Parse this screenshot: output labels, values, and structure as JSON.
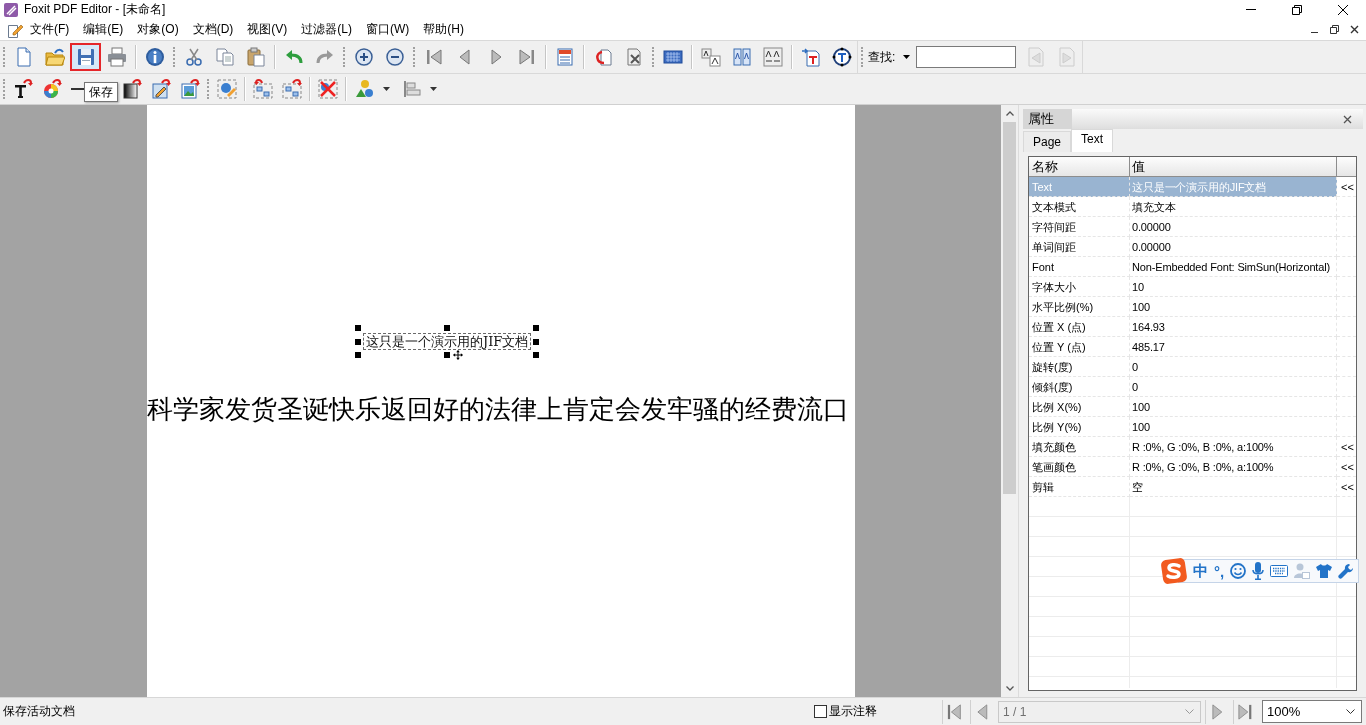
{
  "window": {
    "title": "Foxit PDF Editor - [未命名]"
  },
  "menu": {
    "items": [
      "文件(F)",
      "编辑(E)",
      "对象(O)",
      "文档(D)",
      "视图(V)",
      "过滤器(L)",
      "窗口(W)",
      "帮助(H)"
    ]
  },
  "toolbar_1": {
    "bands": [
      {
        "groups": [
          [
            {
              "kind": "new",
              "highlighted": false
            },
            {
              "kind": "open",
              "highlighted": false
            },
            {
              "kind": "save",
              "highlighted": true
            },
            {
              "kind": "print",
              "highlighted": false
            }
          ],
          [
            {
              "kind": "info",
              "highlighted": false
            }
          ]
        ]
      },
      {
        "groups": [
          [
            {
              "kind": "cut",
              "highlighted": false
            },
            {
              "kind": "copy",
              "highlighted": false
            },
            {
              "kind": "paste",
              "highlighted": false
            }
          ],
          [
            {
              "kind": "undo",
              "highlighted": false
            },
            {
              "kind": "redo",
              "highlighted": false
            }
          ]
        ]
      },
      {
        "groups": [
          [
            {
              "kind": "zoom-in",
              "highlighted": false
            },
            {
              "kind": "zoom-out",
              "highlighted": false
            }
          ]
        ]
      },
      {
        "groups": [
          [
            {
              "kind": "first-page",
              "highlighted": false
            },
            {
              "kind": "previous-page",
              "highlighted": false
            },
            {
              "kind": "next-page",
              "highlighted": false
            },
            {
              "kind": "last-page",
              "highlighted": false
            }
          ],
          [
            {
              "kind": "page-properties",
              "highlighted": false
            }
          ],
          [
            {
              "kind": "rotate-page",
              "highlighted": false
            },
            {
              "kind": "delete-page",
              "highlighted": false
            }
          ]
        ]
      },
      {
        "groups": [
          [
            {
              "kind": "text-grid",
              "highlighted": false
            }
          ],
          [
            {
              "kind": "char-spacing",
              "highlighted": false
            },
            {
              "kind": "word-spacing",
              "highlighted": false
            },
            {
              "kind": "text-scale",
              "highlighted": false
            }
          ],
          [
            {
              "kind": "import-text",
              "highlighted": false
            },
            {
              "kind": "text-frame",
              "highlighted": false
            }
          ]
        ]
      }
    ],
    "find": {
      "label": "查找:",
      "buttons": [
        {
          "kind": "find-previous",
          "disabled": true
        },
        {
          "kind": "find-next",
          "disabled": true
        }
      ]
    }
  },
  "toolbar_2": {
    "bands": [
      {
        "groups": [
          [
            {
              "kind": "text-tool",
              "highlighted": false
            },
            {
              "kind": "color",
              "highlighted": false
            },
            {
              "kind": "line",
              "highlighted": false
            },
            {
              "kind": "gradient",
              "highlighted": false
            },
            {
              "kind": "edit-image",
              "highlighted": false
            },
            {
              "kind": "image",
              "highlighted": false
            }
          ]
        ]
      },
      {
        "groups": [
          [
            {
              "kind": "select-object",
              "highlighted": false
            }
          ],
          [
            {
              "kind": "arrange-back",
              "highlighted": false
            },
            {
              "kind": "arrange-front",
              "highlighted": false
            }
          ],
          [
            {
              "kind": "delete-object",
              "highlighted": false
            }
          ],
          [
            {
              "kind": "shapes",
              "highlighted": false
            },
            {
              "kind": "align",
              "highlighted": false
            }
          ]
        ]
      }
    ]
  },
  "tooltip": {
    "text": "保存"
  },
  "document": {
    "text_box": {
      "text": "这只是一个演示用的JIF文档",
      "selected": true
    },
    "body_line": "科学家发货圣诞快乐返回好的法律上肯定会发牢骚的经费流口"
  },
  "properties": {
    "title": "属性",
    "tabs": [
      {
        "label": "Page",
        "selected": false
      },
      {
        "label": "Text",
        "selected": true
      }
    ],
    "columns": [
      "名称",
      "值"
    ],
    "rows": [
      {
        "name": "Text",
        "value": "这只是一个演示用的JIF文档",
        "action": "<<",
        "selected": true
      },
      {
        "name": "文本模式",
        "value": "填充文本",
        "selected": false
      },
      {
        "name": "字符间距",
        "value": "0.00000",
        "selected": false
      },
      {
        "name": "单词间距",
        "value": "0.00000",
        "selected": false
      },
      {
        "name": "Font",
        "value": "Non-Embedded Font: SimSun(Horizontal)",
        "selected": false
      },
      {
        "name": "字体大小",
        "value": "10",
        "selected": false
      },
      {
        "name": "水平比例(%)",
        "value": "100",
        "selected": false
      },
      {
        "name": "位置 X (点)",
        "value": "164.93",
        "selected": false
      },
      {
        "name": "位置 Y (点)",
        "value": "485.17",
        "selected": false
      },
      {
        "name": "旋转(度)",
        "value": "0",
        "selected": false
      },
      {
        "name": "倾斜(度)",
        "value": "0",
        "selected": false
      },
      {
        "name": "比例 X(%)",
        "value": "100",
        "selected": false
      },
      {
        "name": "比例 Y(%)",
        "value": "100",
        "selected": false
      },
      {
        "name": "填充颜色",
        "value": "R :0%, G :0%, B :0%, a:100%",
        "action": "<<",
        "selected": false
      },
      {
        "name": "笔画颜色",
        "value": "R :0%, G :0%, B :0%, a:100%",
        "action": "<<",
        "selected": false
      },
      {
        "name": "剪辑",
        "value": "空",
        "action": "<<",
        "selected": false
      }
    ]
  },
  "ime_toolbar": {
    "mode": "中",
    "punctuation": "°,"
  },
  "status_bar": {
    "message": "保存活动文档",
    "show_annotations": {
      "label": "显示注释",
      "checked": false
    },
    "page": {
      "value": "1 / 1",
      "disabled": true
    },
    "zoom": "100%"
  }
}
